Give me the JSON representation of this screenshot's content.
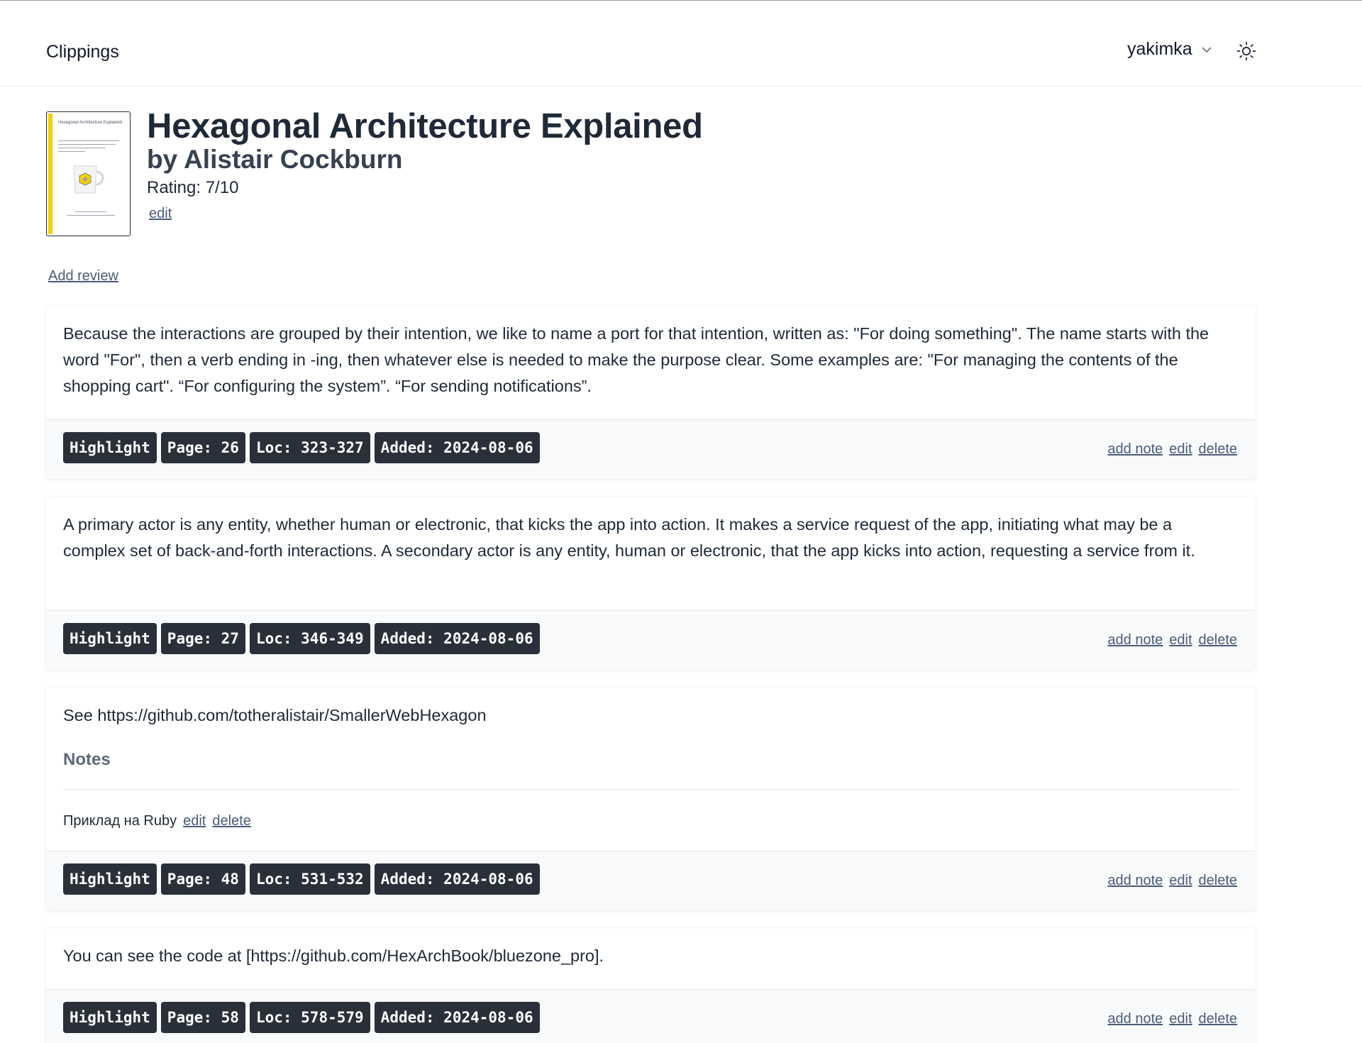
{
  "nav": {
    "brand": "Clippings",
    "user": "yakimka"
  },
  "book": {
    "title": "Hexagonal Architecture Explained",
    "author": "by Alistair Cockburn",
    "rating": "Rating: 7/10",
    "edit_label": "edit",
    "add_review_label": "Add review"
  },
  "clippings": [
    {
      "text": "Because the interactions are grouped by their intention, we like to name a port for that intention, written as: \"For doing something\". The name starts with the word \"For\", then a verb ending in -ing, then whatever else is needed to make the purpose clear. Some examples are: \"For managing the contents of the shopping cart\". “For configuring the system”. “For sending notifications”.",
      "tags": [
        "Highlight",
        "Page: 26",
        "Loc: 323-327",
        "Added: 2024-08-06"
      ]
    },
    {
      "text": "A primary actor is any entity, whether human or electronic, that kicks the app into action. It makes a service request of the app, initiating what may be a complex set of back-and-forth interactions. A secondary actor is any entity, human or electronic, that the app kicks into action, requesting a service from it.",
      "tags": [
        "Highlight",
        "Page: 27",
        "Loc: 346-349",
        "Added: 2024-08-06"
      ]
    },
    {
      "text": "See https://github.com/totheralistair/SmallerWebHexagon",
      "notes_heading": "Notes",
      "notes": [
        {
          "text": "Приклад на Ruby",
          "edit_label": "edit",
          "delete_label": "delete"
        }
      ],
      "tags": [
        "Highlight",
        "Page: 48",
        "Loc: 531-532",
        "Added: 2024-08-06"
      ]
    },
    {
      "text": "You can see the code at [https://github.com/HexArchBook/bluezone_pro].",
      "tags": [
        "Highlight",
        "Page: 58",
        "Loc: 578-579",
        "Added: 2024-08-06"
      ]
    }
  ],
  "actions": {
    "add_note": "add note",
    "edit": "edit",
    "delete": "delete"
  },
  "colors": {
    "tag_bg": "#2a3039",
    "link": "#4b5b7a",
    "cover_accent": "#f5d000"
  }
}
